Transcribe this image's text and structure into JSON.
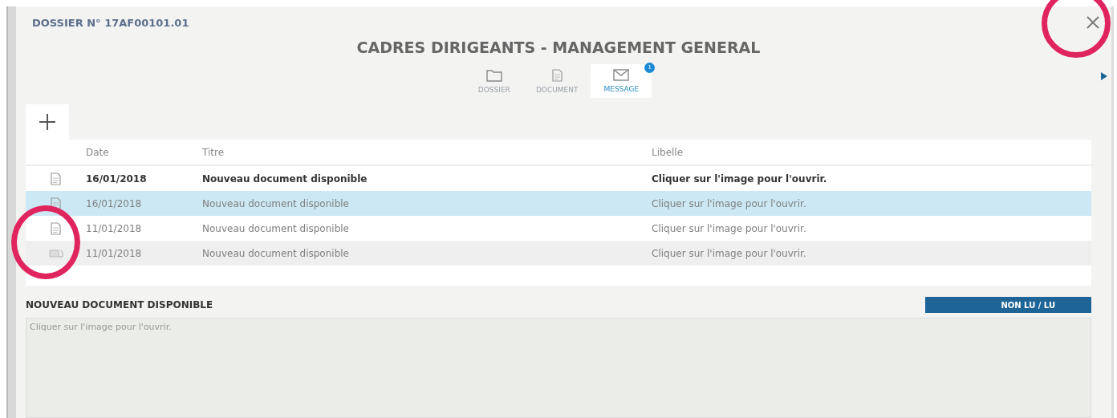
{
  "dossier": {
    "number": "DOSSIER N° 17AF00101.01"
  },
  "title": "CADRES DIRIGEANTS - MANAGEMENT GENERAL",
  "tabs": [
    {
      "label": "DOSSIER",
      "kind": "folder",
      "selected": false
    },
    {
      "label": "DOCUMENT",
      "kind": "document",
      "selected": false
    },
    {
      "label": "MESSAGE",
      "kind": "mail",
      "selected": true,
      "badge": "1"
    }
  ],
  "table": {
    "columns": [
      "Date",
      "Titre",
      "Libelle"
    ],
    "rows": [
      {
        "kind": "document",
        "date": "16/01/2018",
        "titre": "Nouveau document disponible",
        "libelle": "Cliquer sur l'image pour l'ouvrir.",
        "unread": true,
        "selected": false
      },
      {
        "kind": "document",
        "date": "16/01/2018",
        "titre": "Nouveau document disponible",
        "libelle": "Cliquer sur l'image pour l'ouvrir.",
        "unread": false,
        "selected": true
      },
      {
        "kind": "document",
        "date": "11/01/2018",
        "titre": "Nouveau document disponible",
        "libelle": "Cliquer sur l'image pour l'ouvrir.",
        "unread": false,
        "selected": false
      },
      {
        "kind": "open-mail",
        "date": "11/01/2018",
        "titre": "Nouveau document disponible",
        "libelle": "Cliquer sur l'image pour l'ouvrir.",
        "unread": false,
        "selected": false
      }
    ]
  },
  "detail": {
    "heading": "NOUVEAU DOCUMENT DISPONIBLE",
    "toggle_button": "NON LU / LU",
    "body": "Cliquer sur l'image pour l'ouvrir."
  }
}
